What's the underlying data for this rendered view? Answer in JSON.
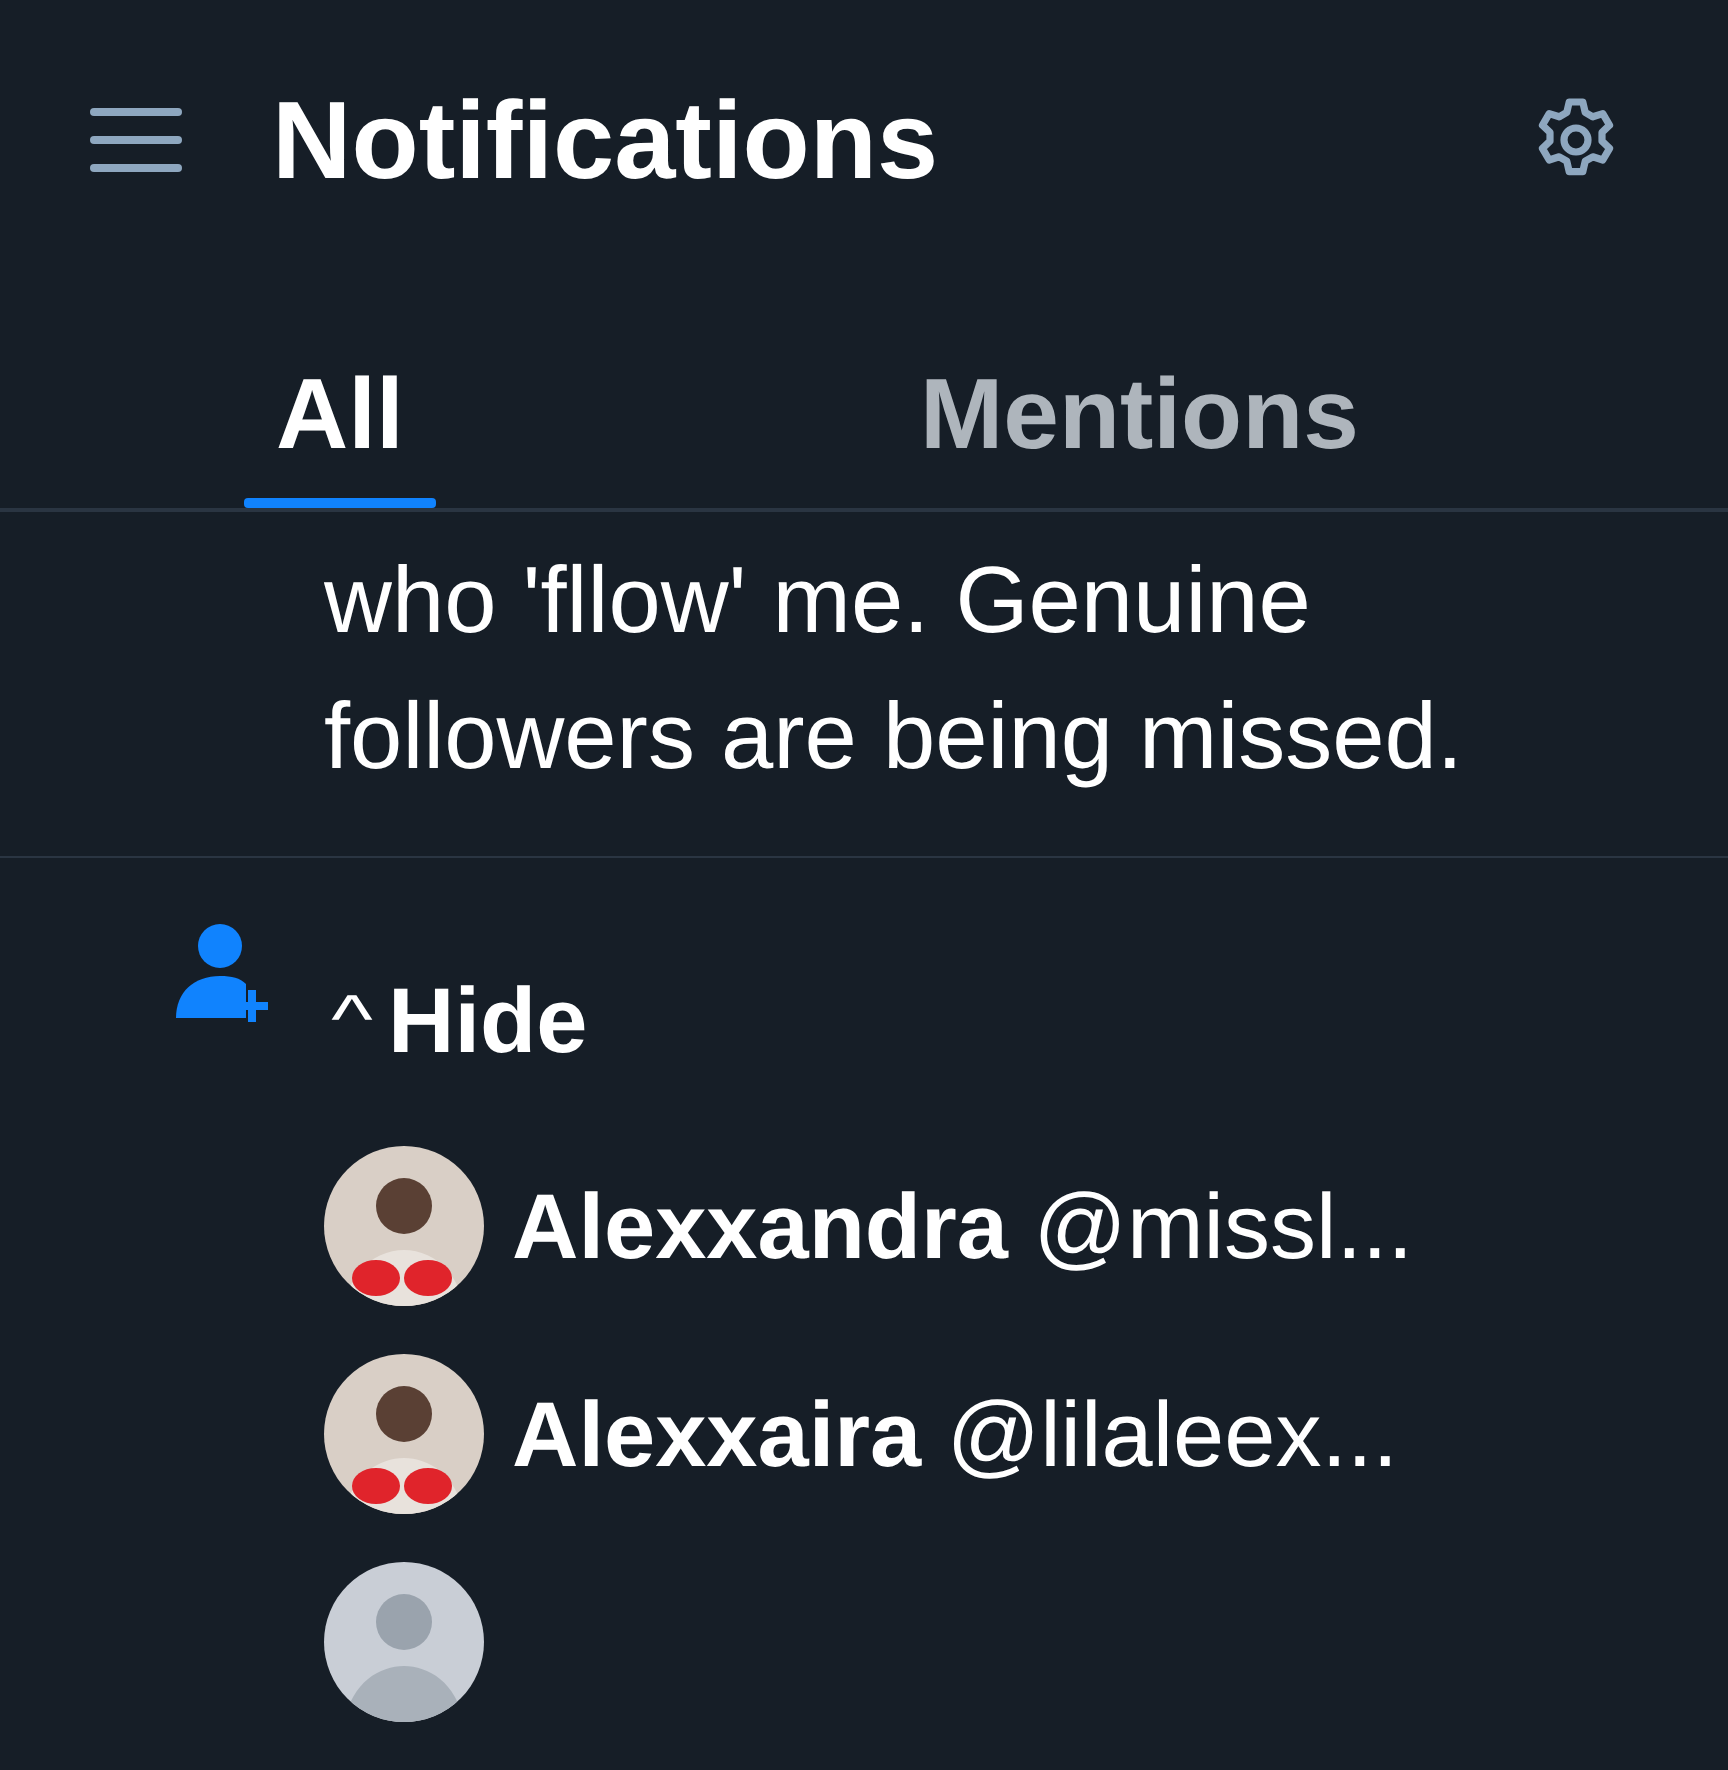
{
  "header": {
    "title": "Notifications"
  },
  "tabs": [
    {
      "label": "All",
      "selected": true
    },
    {
      "label": "Mentions",
      "selected": false
    }
  ],
  "post": {
    "text": "who 'fllow' me. Genuine followers are being missed."
  },
  "follow_group": {
    "expanded": true,
    "toggle_label": "Hide",
    "caret": "^",
    "users": [
      {
        "name": "Alexxandra",
        "handle": "@missl..."
      },
      {
        "name": "Alexxaira",
        "handle": "@lilaleex..."
      },
      {
        "kind": "picture"
      }
    ]
  }
}
